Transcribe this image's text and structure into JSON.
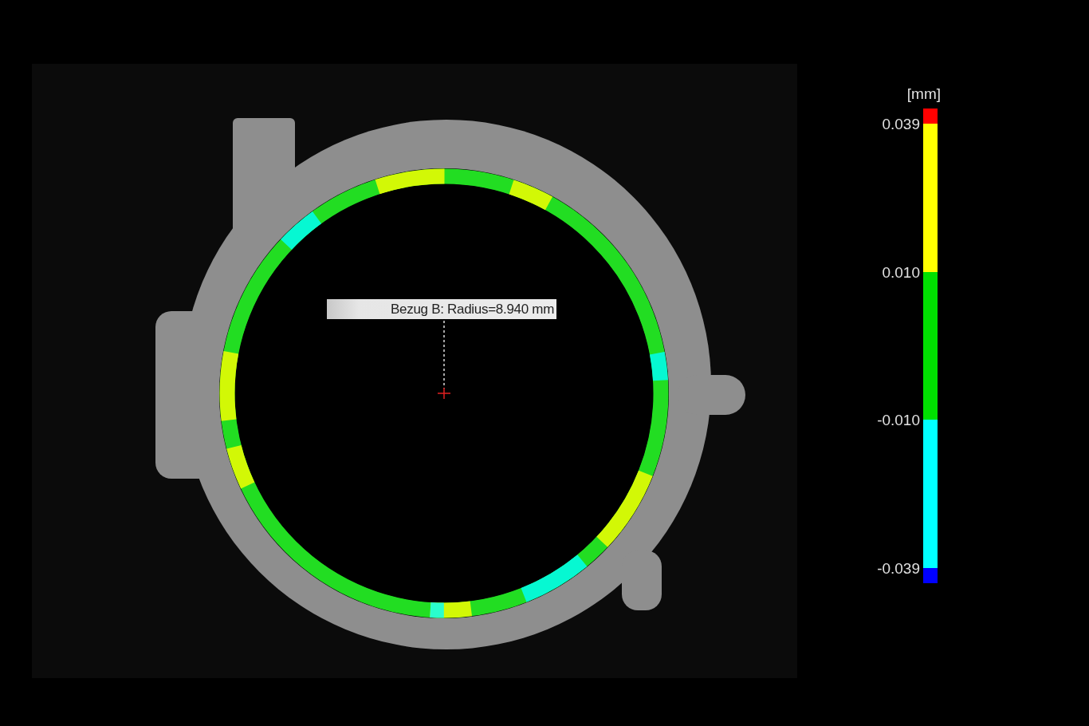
{
  "annotation": {
    "text": "Bezug B: Radius=8.940 mm"
  },
  "legend": {
    "unit": "[mm]",
    "segments": [
      {
        "kind": "end",
        "color": "#ff0000",
        "lower_label": "0.039"
      },
      {
        "kind": "band",
        "color": "#ffff00",
        "lower_label": "0.010"
      },
      {
        "kind": "band",
        "color": "#00e000",
        "lower_label": "-0.010"
      },
      {
        "kind": "band",
        "color": "#00ffff",
        "lower_label": "-0.039"
      },
      {
        "kind": "end",
        "color": "#0000ff"
      }
    ]
  }
}
